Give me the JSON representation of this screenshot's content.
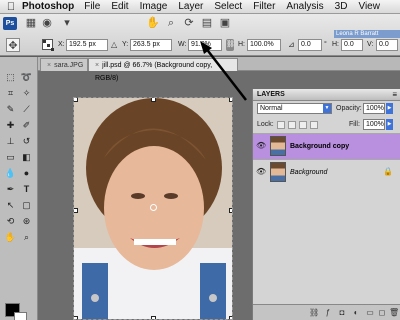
{
  "menubar": {
    "app_name": "Photoshop",
    "items": [
      "File",
      "Edit",
      "Image",
      "Layer",
      "Select",
      "Filter",
      "Analysis",
      "3D",
      "View"
    ]
  },
  "options": {
    "x_label": "X:",
    "x_value": "192.5 px",
    "y_label": "Y:",
    "y_value": "263.5 px",
    "w_label": "W:",
    "w_value": "91.0%",
    "h_label": "H:",
    "h_value": "100.0%",
    "rotate_value": "0.0",
    "rotate_unit": "°",
    "hskew_label": "H:",
    "hskew_value": "0.0",
    "vskew_label": "V:",
    "vskew_value": "0.0",
    "user_tab": "Leona R Barratt"
  },
  "tabs": [
    {
      "label": "sara.JPG"
    },
    {
      "label": "jill.psd @ 66.7% (Background copy, RGB/8)"
    },
    {
      "label": "jill.psd @ 66.7% (Background copy, RGB/8)"
    }
  ],
  "layers_panel": {
    "title": "LAYERS",
    "blend_mode": "Normal",
    "opacity_label": "Opacity:",
    "opacity_value": "100%",
    "lock_label": "Lock:",
    "fill_label": "Fill:",
    "fill_value": "100%",
    "layers": [
      {
        "name": "Background copy",
        "selected": true
      },
      {
        "name": "Background",
        "selected": false
      }
    ]
  },
  "colors": {
    "selected_layer": "#b98fe0",
    "accent_blue": "#3f73d8"
  }
}
